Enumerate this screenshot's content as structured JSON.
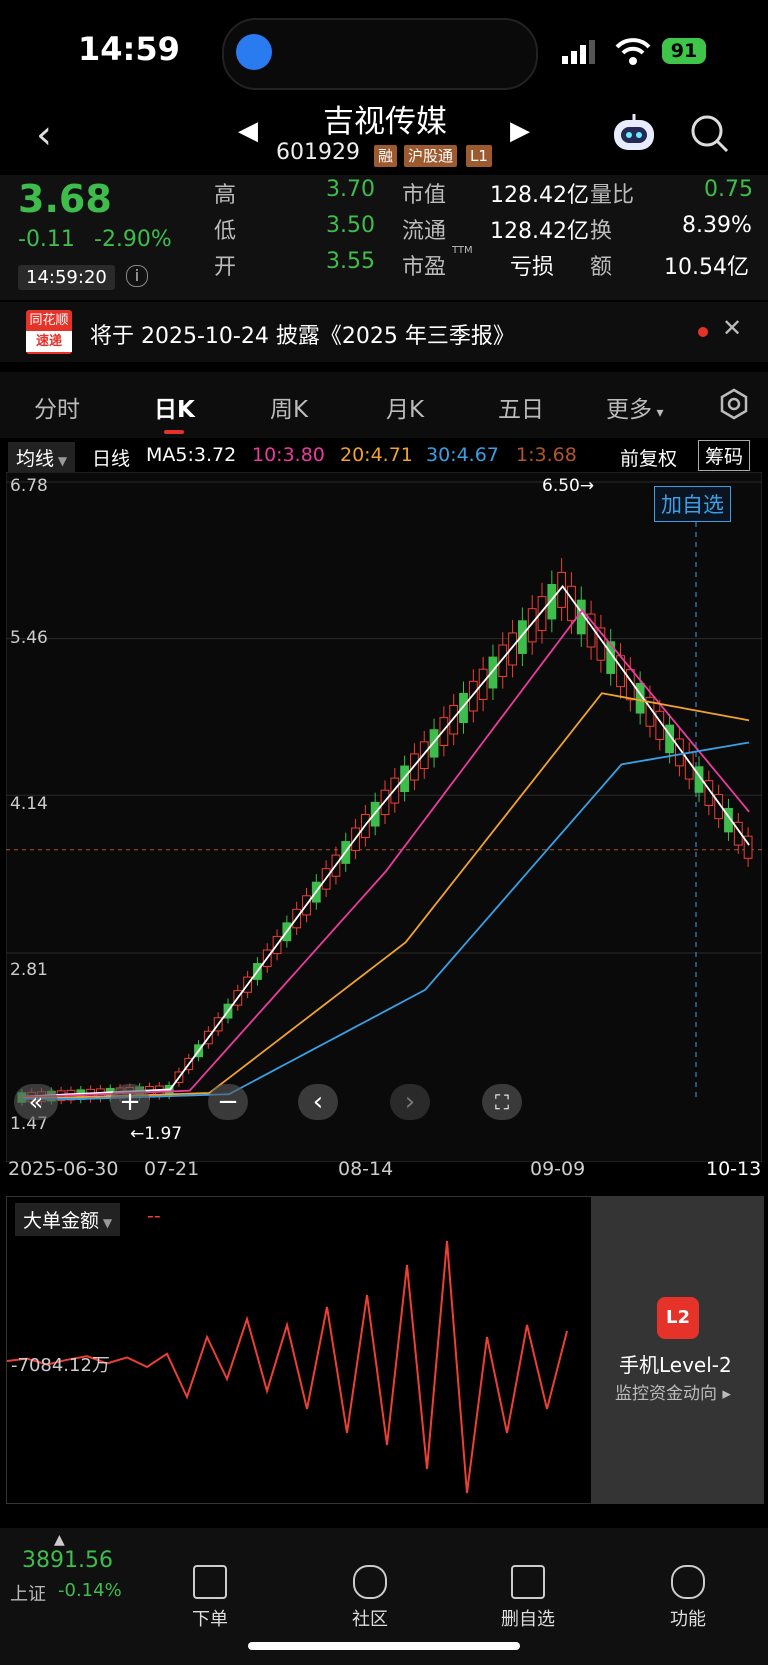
{
  "status": {
    "time": "14:59",
    "battery": "91"
  },
  "header": {
    "title": "吉视传媒",
    "code": "601929",
    "tags": [
      "融",
      "沪股通",
      "L1"
    ]
  },
  "quote": {
    "price": "3.68",
    "change": "-0.11",
    "change_pct": "-2.90%",
    "timestamp": "14:59:20",
    "stats": [
      {
        "label": "高",
        "value": "3.70"
      },
      {
        "label": "低",
        "value": "3.50"
      },
      {
        "label": "开",
        "value": "3.55"
      },
      {
        "label": "市值",
        "value": "128.42亿"
      },
      {
        "label": "流通",
        "value": "128.42亿"
      },
      {
        "label": "市盈",
        "sup": "TTM",
        "value": "亏损"
      },
      {
        "label": "量比",
        "value": "0.75"
      },
      {
        "label": "换",
        "value": "8.39%"
      },
      {
        "label": "额",
        "value": "10.54亿"
      }
    ]
  },
  "notice": {
    "badge_top": "同花顺",
    "badge_bottom": "速递",
    "text": "将于 2025-10-24 披露《2025 年三季报》"
  },
  "tabs": [
    "分时",
    "日K",
    "周K",
    "月K",
    "五日",
    "更多"
  ],
  "indicators": {
    "selector": "均线",
    "period": "日线",
    "ma5": "MA5:3.72",
    "ma10": "10:3.80",
    "ma20": "20:4.71",
    "ma30": "30:4.67",
    "ma1": "1:3.68",
    "adjust": "前复权",
    "chips": "筹码"
  },
  "chart": {
    "y_ticks": [
      "6.78",
      "5.46",
      "4.14",
      "2.81",
      "1.47"
    ],
    "high_label": "6.50→",
    "low_label": "←1.97",
    "add_watch": "加自选",
    "x_ticks": [
      "2025-06-30",
      "07-21",
      "08-14",
      "09-09",
      "10-13"
    ],
    "colors": {
      "up": "#ee3f33",
      "down": "#3ebd4d",
      "ma5": "#ffffff",
      "ma10": "#e93c9c",
      "ma20": "#f0a22f",
      "ma30": "#3aa0e6"
    }
  },
  "chart_data": {
    "type": "line",
    "title": "",
    "xlabel": "",
    "ylabel": "",
    "ylim": [
      1.47,
      6.78
    ],
    "x": [
      "2025-06-30",
      "07-21",
      "08-14",
      "09-09",
      "10-13"
    ],
    "series": [
      {
        "name": "MA5",
        "values": [
          1.6,
          1.66,
          3.9,
          5.9,
          3.72
        ]
      },
      {
        "name": "MA10",
        "values": [
          1.6,
          1.65,
          3.5,
          5.7,
          3.8
        ]
      },
      {
        "name": "MA20",
        "values": [
          1.59,
          1.63,
          2.9,
          5.0,
          4.71
        ]
      },
      {
        "name": "MA30",
        "values": [
          1.58,
          1.62,
          2.5,
          4.4,
          4.67
        ]
      }
    ]
  },
  "lower": {
    "selector": "大单金额",
    "dash": "--",
    "value_label": "-7084.12万",
    "promo_title": "手机Level-2",
    "promo_sub": "监控资金动向"
  },
  "bottom": {
    "index_value": "3891.56",
    "index_name": "上证",
    "index_change": "-0.14%",
    "nav": [
      "下单",
      "社区",
      "删自选",
      "功能"
    ]
  }
}
